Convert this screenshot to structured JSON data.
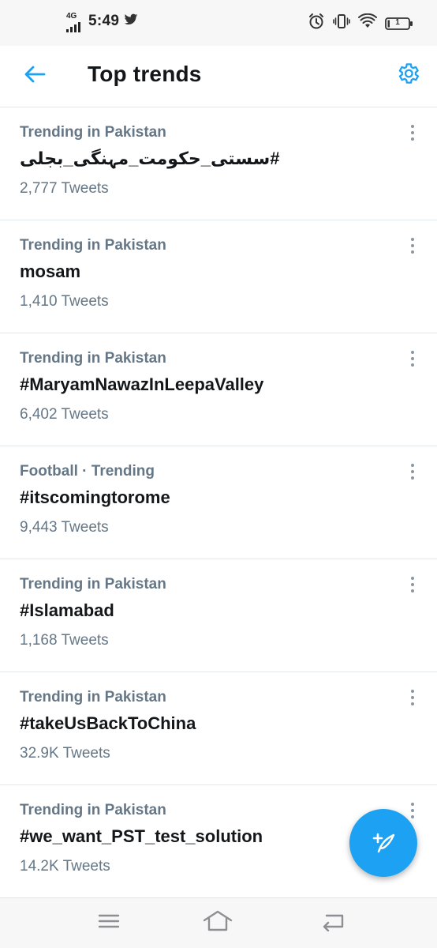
{
  "status_bar": {
    "network": "4G",
    "time": "5:49",
    "battery": "1"
  },
  "header": {
    "title": "Top trends"
  },
  "trends": [
    {
      "context": "Trending in Pakistan",
      "name": "#سستی_حکومت_مہنگی_بجلی",
      "count": "2,777 Tweets"
    },
    {
      "context": "Trending in Pakistan",
      "name": "mosam",
      "count": "1,410 Tweets"
    },
    {
      "context": "Trending in Pakistan",
      "name": "#MaryamNawazInLeepaValley",
      "count": "6,402 Tweets"
    },
    {
      "context": "Football · Trending",
      "name": "#itscomingtorome",
      "count": "9,443 Tweets"
    },
    {
      "context": "Trending in Pakistan",
      "name": "#Islamabad",
      "count": "1,168 Tweets"
    },
    {
      "context": "Trending in Pakistan",
      "name": "#takeUsBackToChina",
      "count": "32.9K Tweets"
    },
    {
      "context": "Trending in Pakistan",
      "name": "#we_want_PST_test_solution",
      "count": "14.2K Tweets"
    }
  ],
  "colors": {
    "accent": "#1da1f2",
    "secondary_text": "#657786",
    "primary_text": "#14171a",
    "divider": "#e1e8ed"
  },
  "icons": {
    "back": "arrow-left-icon",
    "settings": "gear-icon",
    "more": "more-vertical-icon",
    "compose": "compose-tweet-icon",
    "nav_menu": "menu-icon",
    "nav_home": "home-icon",
    "nav_back": "back-icon"
  }
}
